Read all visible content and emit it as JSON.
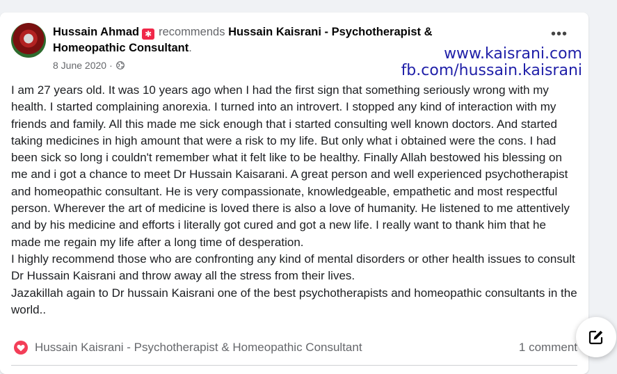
{
  "post": {
    "author": "Hussain Ahmad",
    "action": "recommends",
    "page": "Hussain Kaisrani - Psychotherapist & Homeopathic Consultant",
    "date": "8 June 2020",
    "separator": "·",
    "paragraphs": [
      "I am 27 years old. It was 10 years ago when I had the first sign that something seriously wrong with my health. I started complaining anorexia. I turned into an introvert. I stopped any kind of interaction with my friends and family. All this made me sick enough that i started consulting well known doctors. And started taking medicines in high amount that were a risk to my life. But only what i obtained were the cons. I had been sick so long i couldn't remember what it felt like to be healthy. Finally Allah bestowed his blessing on me and i got a chance to meet Dr Hussain Kaisarani. A great person and well experienced psychotherapist and homeopathic consultant. He is very compassionate, knowledgeable, empathetic and most respectful person. Wherever the art of medicine is loved there is also a love of humanity. He listened to me attentively and by his medicine and efforts i literally got cured and got a new life. I really want to thank him that he made me regain my life after a long time of desperation.",
      "I highly recommend those who are confronting any kind of mental disorders or other health issues to consult Dr Hussain Kaisrani and throw away all the stress from their lives.",
      "Jazakillah again to Dr hussain Kaisrani one of the best psychotherapists and homeopathic consultants in the world.."
    ],
    "reaction_label": "Hussain Kaisrani - Psychotherapist & Homeopathic Consultant",
    "comment_count": "1 comment"
  },
  "watermark": {
    "line1": "www.kaisrani.com",
    "line2": "fb.com/hussain.kaisrani"
  },
  "icons": {
    "more": "more-options-icon",
    "globe": "globe-icon",
    "heart": "heart-reaction-icon",
    "compose": "compose-icon"
  },
  "colors": {
    "reaction": "#f33e58",
    "badge": "#f02849",
    "watermark": "#1f1fa8"
  }
}
